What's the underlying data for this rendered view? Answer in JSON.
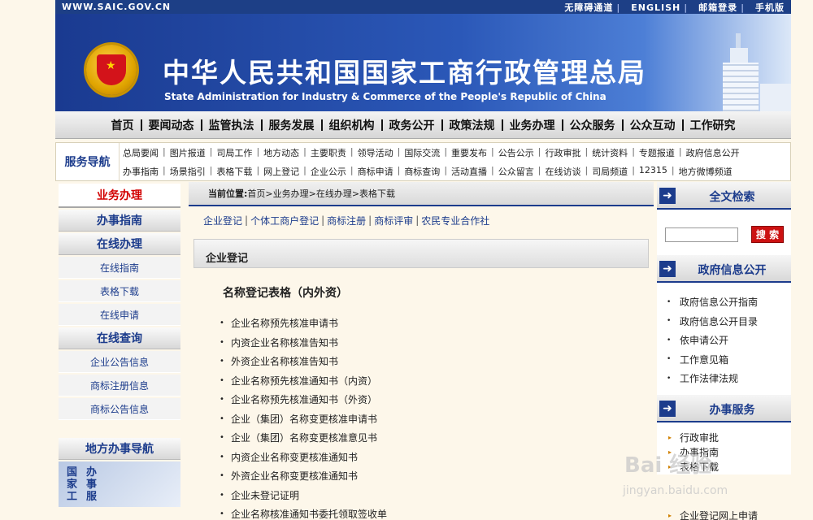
{
  "topbar": {
    "url": "WWW.SAIC.GOV.CN",
    "links": [
      "无障碍通道",
      "ENGLISH",
      "邮箱登录",
      "手机版"
    ]
  },
  "banner": {
    "cn_title": "中华人民共和国国家工商行政管理总局",
    "en_title": "State Administration for Industry & Commerce of the People's Republic of China"
  },
  "mainnav": [
    "首页",
    "要闻动态",
    "监管执法",
    "服务发展",
    "组织机构",
    "政务公开",
    "政策法规",
    "业务办理",
    "公众服务",
    "公众互动",
    "工作研究"
  ],
  "svcnav": {
    "label": "服务导航",
    "row1": [
      "总局要闻",
      "图片报道",
      "司局工作",
      "地方动态",
      "主要职责",
      "领导活动",
      "国际交流",
      "重要发布",
      "公告公示",
      "行政审批",
      "统计资料",
      "专题报道",
      "政府信息公开"
    ],
    "row2": [
      "办事指南",
      "场景指引",
      "表格下载",
      "网上登记",
      "企业公示",
      "商标申请",
      "商标查询",
      "活动直播",
      "公众留言",
      "在线访谈",
      "司局频道",
      "12315",
      "地方微博频道"
    ]
  },
  "left": {
    "head": "业务办理",
    "sec1": "办事指南",
    "sec2": "在线办理",
    "items2": [
      "在线指南",
      "表格下载",
      "在线申请"
    ],
    "sec3": "在线查询",
    "items3": [
      "企业公告信息",
      "商标注册信息",
      "商标公告信息"
    ],
    "sec4": "地方办事导航",
    "photo_text": [
      "国",
      "家",
      "工",
      "办",
      "事",
      "服"
    ]
  },
  "center": {
    "crumb_label": "当前位置:",
    "crumb_path": "首页>业务办理>在线办理>表格下载",
    "tabs": [
      "企业登记",
      "个体工商户登记",
      "商标注册",
      "商标评审",
      "农民专业合作社"
    ],
    "section": "企业登记",
    "title": "名称登记表格（内外资）",
    "bullet": "•",
    "files": [
      "企业名称预先核准申请书",
      "内资企业名称核准告知书",
      "外资企业名称核准告知书",
      "企业名称预先核准通知书（内资）",
      "企业名称预先核准通知书（外资）",
      "企业（集团）名称变更核准申请书",
      "企业（集团）名称变更核准意见书",
      "内资企业名称变更核准通知书",
      "外资企业名称变更核准通知书",
      "企业未登记证明",
      "企业名称核准通知书委托领取签收单"
    ]
  },
  "right": {
    "arrow": "➜",
    "search_head": "全文检索",
    "search_placeholder": "",
    "search_button": "搜 索",
    "info_head": "政府信息公开",
    "info_items": [
      "政府信息公开指南",
      "政府信息公开目录",
      "依申请公开",
      "工作意见箱",
      "工作法律法规"
    ],
    "svc_head": "办事服务",
    "svc_items": [
      "行政审批",
      "办事指南",
      "表格下载"
    ],
    "svc_extra": "企业登记网上申请",
    "svc_bullet": "▸"
  },
  "watermark": {
    "main": "Bai 经验",
    "sub": "jingyan.baidu.com"
  },
  "colors": {
    "brand_blue": "#1c3c8c",
    "accent_red": "#d20000"
  }
}
